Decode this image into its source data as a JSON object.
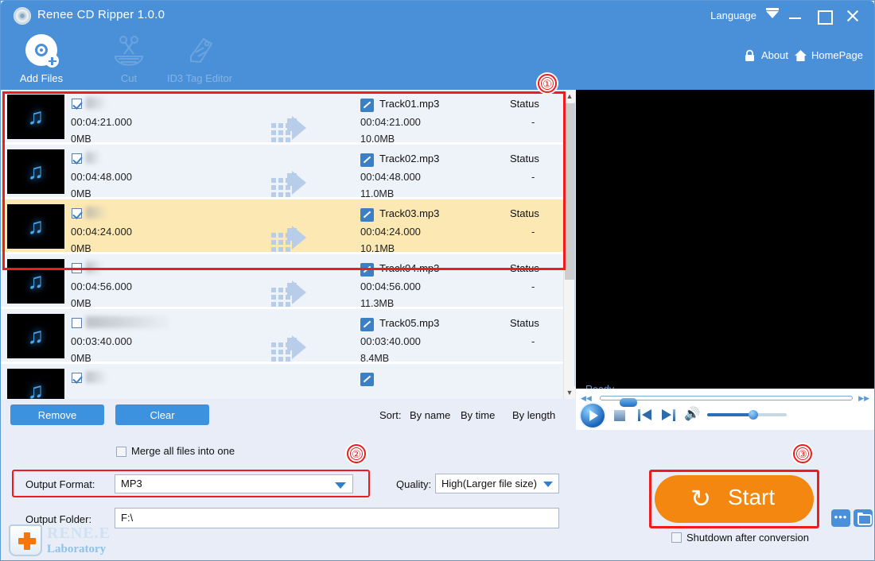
{
  "window": {
    "title": "Renee CD Ripper 1.0.0",
    "app_icon": "cd-disc-icon",
    "language_label": "Language",
    "minimize": "minimize-button",
    "maximize": "maximize-button",
    "close": "close-button",
    "accent_blue": "#4a90d9",
    "accent_orange": "#f3870f",
    "highlight_red": "#ee1c1c"
  },
  "toolbar": {
    "items": [
      {
        "label": "Add Files",
        "icon": "add-disc-icon",
        "enabled": true
      },
      {
        "label": "Cut",
        "icon": "scissors-icon",
        "enabled": false
      },
      {
        "label": "ID3 Tag Editor",
        "icon": "tag-pencil-icon",
        "enabled": false
      }
    ],
    "about_label": "About",
    "about_icon": "lock-icon",
    "homepage_label": "HomePage",
    "homepage_icon": "home-icon"
  },
  "list": {
    "status_header": "Status",
    "rows": [
      {
        "source_time": "00:04:21.000",
        "source_size": "0MB",
        "output_name": "Track01.mp3",
        "output_time": "00:04:21.000",
        "output_size": "10.0MB",
        "status_label": "Status",
        "status_value": "-",
        "checked": true,
        "selected": false,
        "name_redacted": true,
        "redacted_width": 26
      },
      {
        "source_time": "00:04:48.000",
        "source_size": "0MB",
        "output_name": "Track02.mp3",
        "output_time": "00:04:48.000",
        "output_size": "11.0MB",
        "status_label": "Status",
        "status_value": "-",
        "checked": true,
        "selected": false,
        "name_redacted": true,
        "redacted_width": 18
      },
      {
        "source_time": "00:04:24.000",
        "source_size": "0MB",
        "output_name": "Track03.mp3",
        "output_time": "00:04:24.000",
        "output_size": "10.1MB",
        "status_label": "Status",
        "status_value": "-",
        "checked": true,
        "selected": true,
        "name_redacted": true,
        "redacted_width": 26
      },
      {
        "source_time": "00:04:56.000",
        "source_size": "0MB",
        "output_name": "Track04.mp3",
        "output_time": "00:04:56.000",
        "output_size": "11.3MB",
        "status_label": "Status",
        "status_value": "-",
        "checked": false,
        "selected": false,
        "name_redacted": true,
        "redacted_width": 20
      },
      {
        "source_time": "00:03:40.000",
        "source_size": "0MB",
        "output_name": "Track05.mp3",
        "output_time": "00:03:40.000",
        "output_size": "8.4MB",
        "status_label": "Status",
        "status_value": "-",
        "checked": false,
        "selected": false,
        "name_redacted": true,
        "redacted_width": 105
      }
    ],
    "thumbnail_icon": "music-note-icon",
    "convert_arrow_icon": "arrow-right-icon",
    "edit_icon": "pencil-edit-icon",
    "scroll_up_icon": "chevron-up-icon",
    "scroll_down_icon": "chevron-down-icon"
  },
  "list_toolbar": {
    "remove_label": "Remove",
    "clear_label": "Clear",
    "sort_label": "Sort:",
    "sort_options": [
      "By name",
      "By time",
      "By length"
    ]
  },
  "preview": {
    "status_text": "Ready",
    "rewind_icon": "rewind-icon",
    "forward_icon": "fast-forward-icon",
    "play_icon": "play-icon",
    "stop_icon": "stop-icon",
    "previous_icon": "skip-previous-icon",
    "next_icon": "skip-next-icon",
    "volume_icon": "volume-icon",
    "seek_position_percent": 7,
    "volume_percent": 58
  },
  "settings": {
    "merge_label": "Merge all files into one",
    "merge_checked": false,
    "output_format_label": "Output Format:",
    "output_format_value": "MP3",
    "quality_label": "Quality:",
    "quality_value": "High(Larger file size)",
    "output_folder_label": "Output Folder:",
    "output_folder_value": "F:\\",
    "browse_dots_label": "•••",
    "browse_folder_icon": "folder-open-icon",
    "start_label": "Start",
    "start_icon": "refresh-cycle-icon",
    "shutdown_label": "Shutdown after conversion",
    "shutdown_checked": false
  },
  "annotations": {
    "badge1": "①",
    "badge2": "②",
    "badge3": "③"
  },
  "logo": {
    "line1": "RENE.E",
    "line2": "Laboratory",
    "icon": "medical-case-icon"
  }
}
